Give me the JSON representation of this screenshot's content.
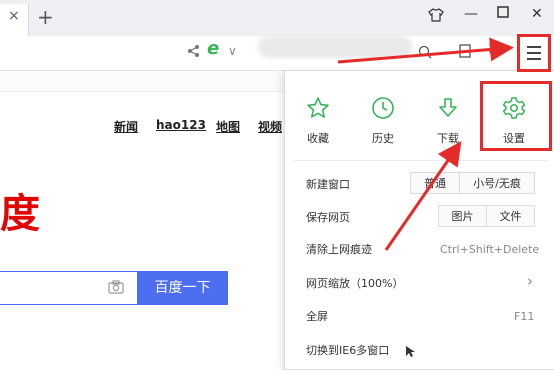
{
  "tabs": {
    "close_glyph": "×",
    "new_tab_glyph": "+"
  },
  "window_controls": {
    "skin": "shirt-icon",
    "minimize": "—",
    "maximize": "□",
    "close": "✕"
  },
  "toolbar": {
    "share": "share-icon",
    "ie_mode": "e",
    "dropdown": "∨"
  },
  "page": {
    "nav": [
      "新闻",
      "hao123",
      "地图",
      "视频"
    ],
    "logo_fragment": "度",
    "search_button": "百度一下"
  },
  "menu": {
    "quick": [
      {
        "label": "收藏",
        "icon": "star-icon"
      },
      {
        "label": "历史",
        "icon": "clock-icon"
      },
      {
        "label": "下载",
        "icon": "download-icon"
      },
      {
        "label": "设置",
        "icon": "gear-icon"
      }
    ],
    "items": {
      "new_window": "新建窗口",
      "new_window_normal": "普通",
      "new_window_private": "小号/无痕",
      "save_page": "保存网页",
      "save_image": "图片",
      "save_file": "文件",
      "clear_history": "清除上网痕迹",
      "clear_history_shortcut": "Ctrl+Shift+Delete",
      "zoom": "网页缩放（100%）",
      "zoom_arrow": "›",
      "fullscreen": "全屏",
      "fullscreen_shortcut": "F11",
      "switch_ie6": "切换到IE6多窗口"
    }
  },
  "colors": {
    "accent_green": "#35b558",
    "annotation_red": "#e52a2a",
    "baidu_blue": "#4e6ef2",
    "baidu_red": "#e10602"
  }
}
